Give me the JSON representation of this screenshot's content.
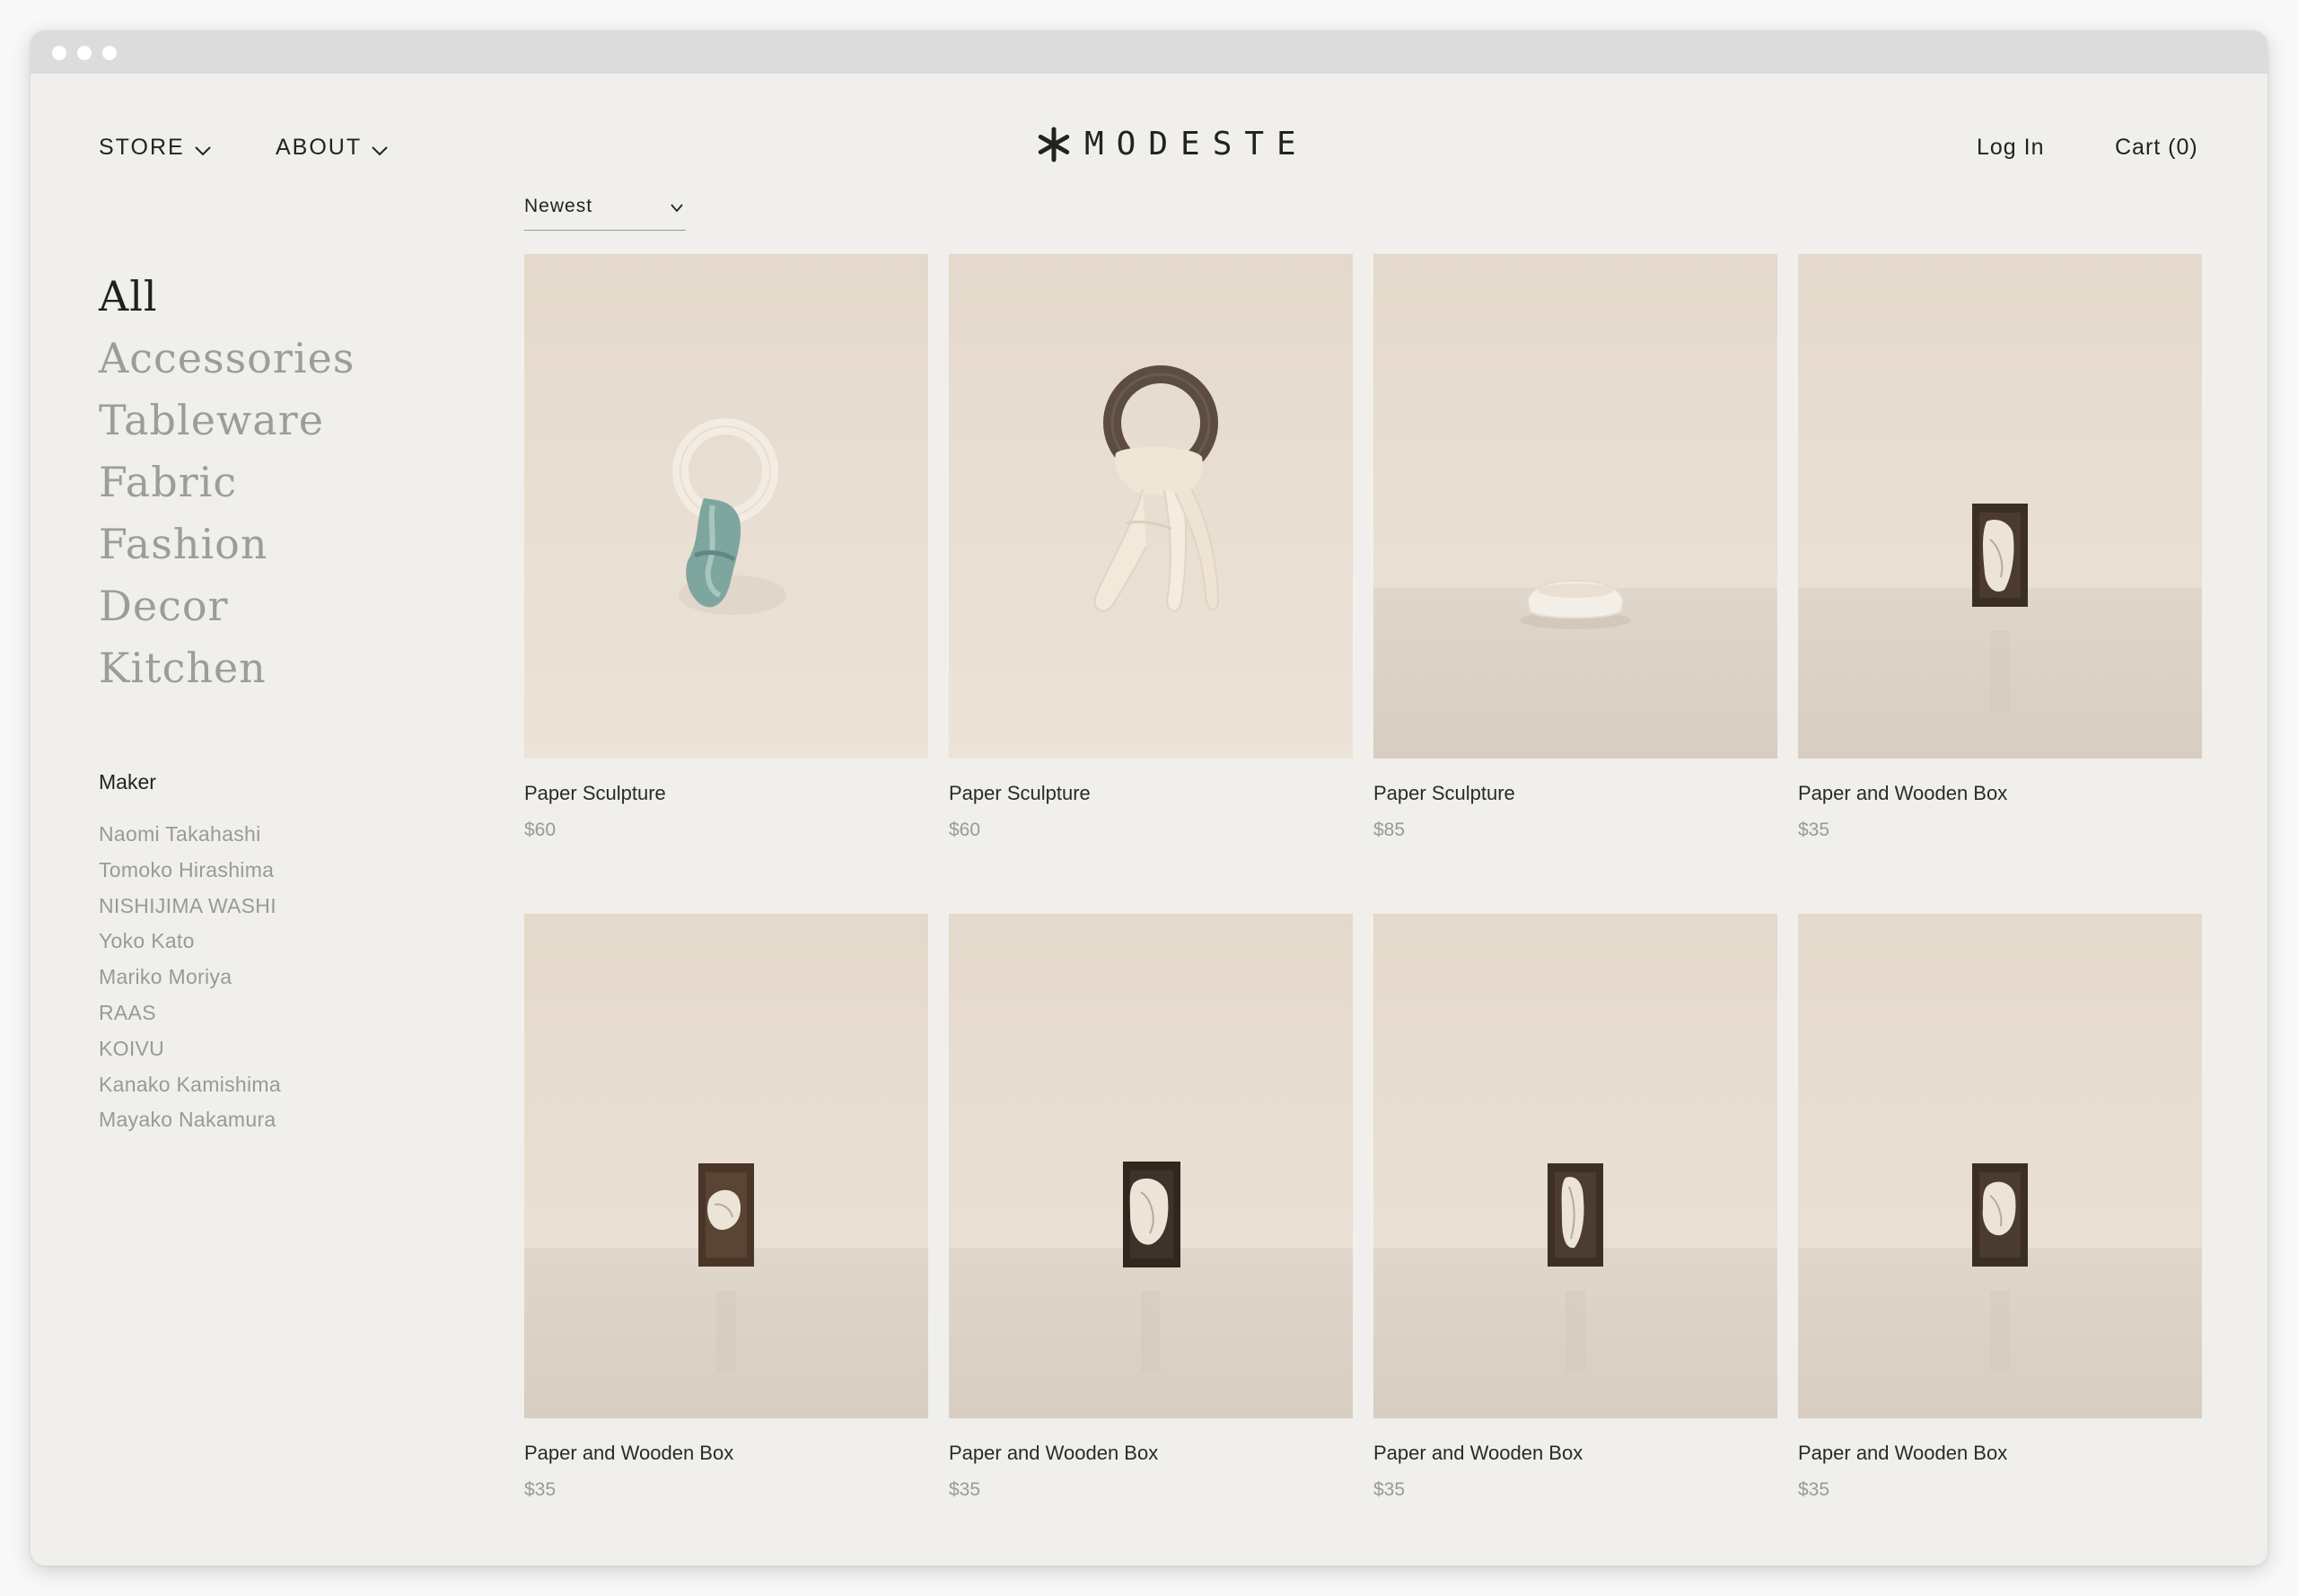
{
  "nav": {
    "store_label": "STORE",
    "about_label": "ABOUT",
    "login_label": "Log In",
    "cart_label": "Cart (0)"
  },
  "logo": {
    "text": "MODESTE",
    "icon": "asterisk-logo-icon"
  },
  "sort": {
    "selected": "Newest"
  },
  "sidebar": {
    "categories": [
      {
        "label": "All",
        "active": true
      },
      {
        "label": "Accessories",
        "active": false
      },
      {
        "label": "Tableware",
        "active": false
      },
      {
        "label": "Fabric",
        "active": false
      },
      {
        "label": "Fashion",
        "active": false
      },
      {
        "label": "Decor",
        "active": false
      },
      {
        "label": "Kitchen",
        "active": false
      }
    ],
    "maker_title": "Maker",
    "makers": [
      "Naomi Takahashi",
      "Tomoko Hirashima",
      "NISHIJIMA WASHI",
      "Yoko Kato",
      "Mariko Moriya",
      "RAAS",
      "KOIVU",
      "Kanako Kamishima",
      "Mayako Nakamura"
    ]
  },
  "products": [
    {
      "title": "Paper Sculpture",
      "price": "$60",
      "image": "white-ring-with-green-fabric"
    },
    {
      "title": "Paper Sculpture",
      "price": "$60",
      "image": "dark-ring-with-cream-fabric"
    },
    {
      "title": "Paper Sculpture",
      "price": "$85",
      "image": "paper-bowl-on-floor"
    },
    {
      "title": "Paper and Wooden Box",
      "price": "$35",
      "image": "wooden-box-frame"
    },
    {
      "title": "Paper and Wooden Box",
      "price": "$35",
      "image": "wooden-box-frame"
    },
    {
      "title": "Paper and Wooden Box",
      "price": "$35",
      "image": "wooden-box-frame"
    },
    {
      "title": "Paper and Wooden Box",
      "price": "$35",
      "image": "wooden-box-frame"
    },
    {
      "title": "Paper and Wooden Box",
      "price": "$35",
      "image": "wooden-box-frame"
    }
  ],
  "colors": {
    "page_background": "#f0efeb",
    "titlebar": "#dcdcdc",
    "text_primary": "#222222",
    "text_muted": "#999999",
    "photo_backdrop": "#e4d9cb"
  }
}
